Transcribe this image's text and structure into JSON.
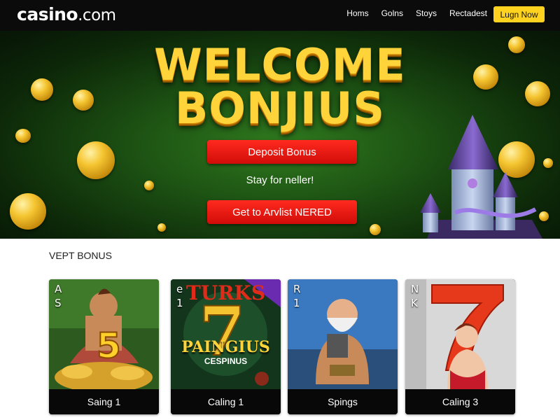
{
  "header": {
    "logo_main": "casino",
    "logo_suffix": ".com",
    "nav": [
      "Homs",
      "Golns",
      "Stoys",
      "Rectadest"
    ],
    "login_label": "Lugn Now"
  },
  "hero": {
    "title_line1": "WELCOME",
    "title_line2": "BONJIUS",
    "deposit_button": "Deposit Bonus",
    "subtitle": "Stay for neller!",
    "cta_button": "Get to Arvlist NERED"
  },
  "section": {
    "title": "VEPT BONUS"
  },
  "cards": [
    {
      "tag_line1": "A",
      "tag_line2": "S",
      "caption": "Saing 1",
      "icon": "warrior-slot-art"
    },
    {
      "tag_line1": "e",
      "tag_line2": "1",
      "caption": "Caling 1",
      "icon": "lucky-seven-slot-art",
      "art_title": "PAINGIUS",
      "art_sub": "CESPINUS",
      "banner": "TURKS"
    },
    {
      "tag_line1": "R",
      "tag_line2": "1",
      "caption": "Spings",
      "icon": "viking-slot-art"
    },
    {
      "tag_line1": "N",
      "tag_line2": "K",
      "caption": "Caling 3",
      "icon": "seven-lady-slot-art"
    }
  ],
  "colors": {
    "header_bg": "#0b0b0b",
    "accent_yellow": "#ffd21f",
    "button_red": "#e0140e",
    "hero_green": "#1b4e12",
    "title_gold": "#ffd43a"
  }
}
